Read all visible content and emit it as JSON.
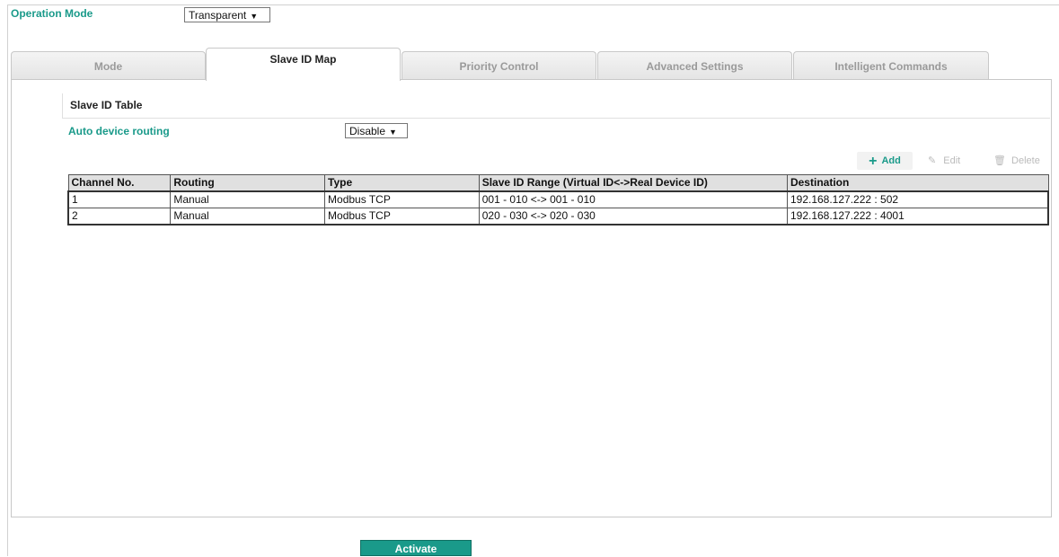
{
  "operation_mode": {
    "label": "Operation Mode",
    "value": "Transparent"
  },
  "tabs": [
    {
      "label": "Mode"
    },
    {
      "label": "Slave ID Map"
    },
    {
      "label": "Priority Control"
    },
    {
      "label": "Advanced Settings"
    },
    {
      "label": "Intelligent Commands"
    }
  ],
  "active_tab": "Slave ID Map",
  "section": {
    "title": "Slave ID Table"
  },
  "auto_routing": {
    "label": "Auto device routing",
    "value": "Disable"
  },
  "toolbar": {
    "add_label": "Add",
    "edit_label": "Edit",
    "delete_label": "Delete"
  },
  "table": {
    "headers": [
      "Channel No.",
      "Routing",
      "Type",
      "Slave ID Range (Virtual ID<->Real Device ID)",
      "Destination"
    ],
    "rows": [
      [
        "1",
        "Manual",
        "Modbus TCP",
        "001 - 010 <-> 001 - 010",
        "192.168.127.222 : 502"
      ],
      [
        "2",
        "Manual",
        "Modbus TCP",
        "020 - 030 <-> 020 - 030",
        "192.168.127.222 : 4001"
      ]
    ]
  },
  "activate": {
    "label": "Activate"
  },
  "colors": {
    "accent": "#1a9a8a",
    "header_bg": "#e0e0e0"
  }
}
